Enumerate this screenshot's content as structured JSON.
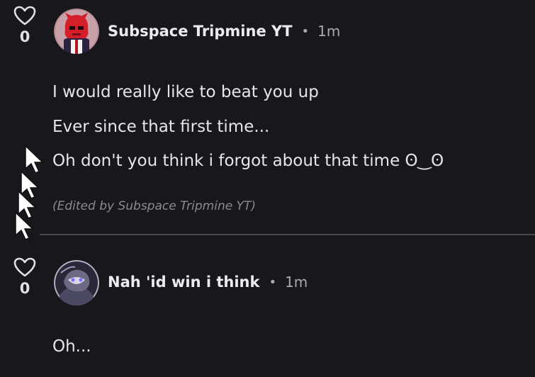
{
  "comments": [
    {
      "votes": "0",
      "username": "Subspace Tripmine YT",
      "separator": "•",
      "time": "1m",
      "lines": [
        "I would really like to beat you up",
        "Ever since that first time...",
        "Oh don't you think i forgot about that time ʘ‿ʘ"
      ],
      "edited_note": "(Edited by Subspace Tripmine YT)"
    },
    {
      "votes": "0",
      "username": "Nah 'id win i think",
      "separator": "•",
      "time": "1m",
      "lines": [
        "Oh..."
      ]
    }
  ],
  "icons": {
    "like": "heart-icon",
    "pointer": "mouse-cursor-icon"
  },
  "colors": {
    "background": "#18181c",
    "text": "#ececee",
    "muted": "#a9a9b0",
    "edited": "#8a8a92",
    "divider": "#46464c"
  }
}
